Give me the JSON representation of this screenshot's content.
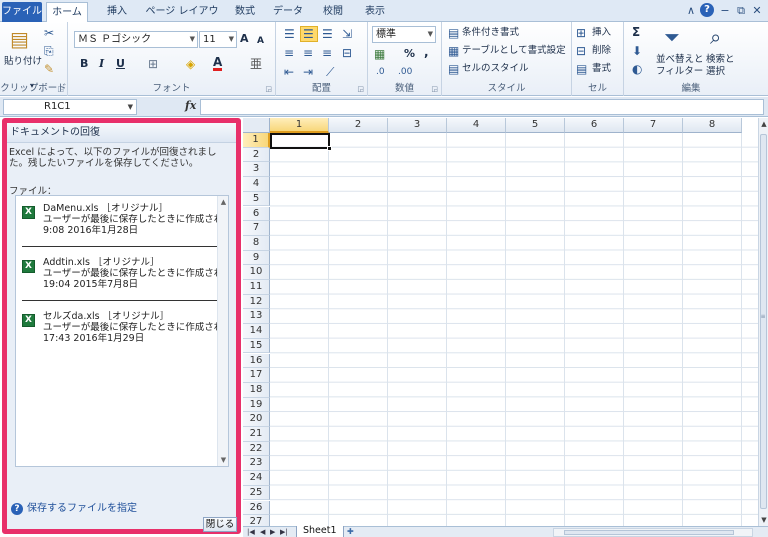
{
  "tabs": [
    "ファイル",
    "ホーム",
    "挿入",
    "ページ レイアウト",
    "数式",
    "データ",
    "校閲",
    "表示"
  ],
  "window_controls": [
    "∧",
    "?",
    "−",
    "⧉",
    "✕"
  ],
  "ribbon": {
    "clipboard": {
      "paste": "貼り付け",
      "label": "クリップボード"
    },
    "font": {
      "name": "ＭＳ Ｐゴシック",
      "size": "11",
      "label": "フォント",
      "grow": "A",
      "shrink": "A",
      "bold": "B",
      "italic": "I",
      "underline": "U",
      "font_color": "A"
    },
    "alignment": {
      "label": "配置"
    },
    "number": {
      "format": "標準",
      "percent": "%",
      "comma": ",",
      "label": "数値"
    },
    "styles": {
      "conditional": "条件付き書式",
      "table": "テーブルとして書式設定",
      "cell_styles": "セルのスタイル",
      "label": "スタイル"
    },
    "cells": {
      "insert": "挿入",
      "delete": "削除",
      "format": "書式",
      "label": "セル"
    },
    "editing": {
      "sort": "並べ替えと",
      "sort2": "フィルター",
      "find": "検索と",
      "find2": "選択",
      "sigma": "Σ",
      "label": "編集"
    }
  },
  "formula_bar": {
    "name_box": "R1C1",
    "fx": "fx"
  },
  "recovery_pane": {
    "title": "ドキュメントの回復",
    "message": "Excel によって、以下のファイルが回復されました。残したいファイルを保存してください。",
    "files_label": "ファイル：",
    "files": [
      {
        "name": "DaMenu.xls ［オリジナル］",
        "desc": "ユーザーが最後に保存したときに作成された...",
        "time": "9:08  2016年1月28日"
      },
      {
        "name": "Addtin.xls ［オリジナル］",
        "desc": "ユーザーが最後に保存したときに作成された...",
        "time": "19:04  2015年7月8日"
      },
      {
        "name": "セルズda.xls ［オリジナル］",
        "desc": "ユーザーが最後に保存したときに作成された...",
        "time": "17:43  2016年1月29日"
      }
    ],
    "help_link": "保存するファイルを指定",
    "close": "閉じる"
  },
  "grid": {
    "columns": [
      "1",
      "2",
      "3",
      "4",
      "5",
      "6",
      "7",
      "8"
    ],
    "rows": [
      "1",
      "2",
      "3",
      "4",
      "5",
      "6",
      "7",
      "8",
      "9",
      "10",
      "11",
      "12",
      "13",
      "14",
      "15",
      "16",
      "17",
      "18",
      "19",
      "20",
      "21",
      "22",
      "23",
      "24",
      "25",
      "26",
      "27"
    ]
  },
  "sheet_tab": "Sheet1"
}
